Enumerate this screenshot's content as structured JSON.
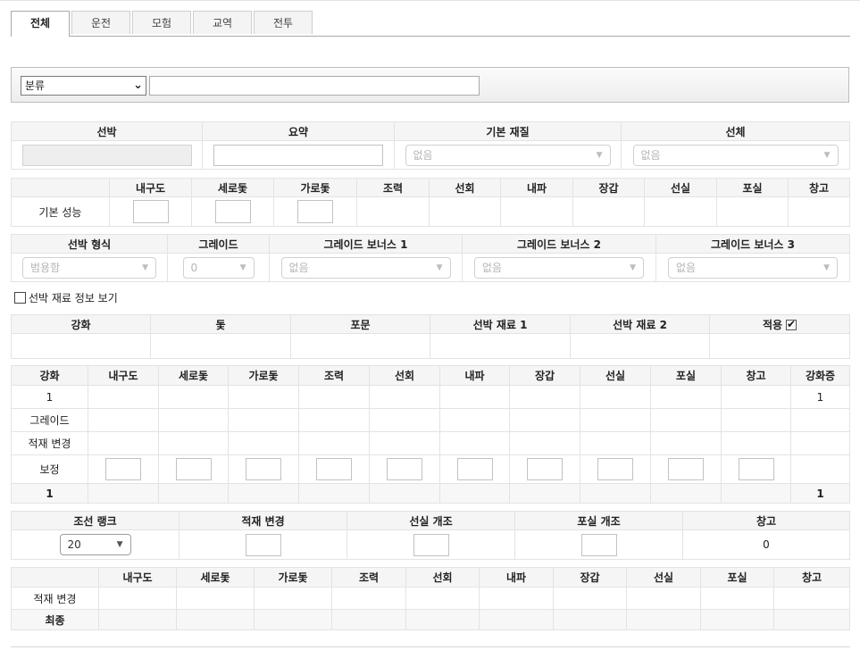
{
  "tabs": [
    "전체",
    "운전",
    "모험",
    "교역",
    "전투"
  ],
  "filter": {
    "category_value": "분류",
    "search_value": ""
  },
  "ship_info": {
    "headers": [
      "선박",
      "요약",
      "기본 재질",
      "선체"
    ],
    "material_value": "없음",
    "hull_value": "없음"
  },
  "base_perf": {
    "headers": [
      "",
      "내구도",
      "세로돛",
      "가로돛",
      "조력",
      "선회",
      "내파",
      "장갑",
      "선실",
      "포실",
      "창고"
    ],
    "row_label": "기본 성능"
  },
  "ship_type": {
    "headers": [
      "선박 형식",
      "그레이드",
      "그레이드 보너스 1",
      "그레이드 보너스 2",
      "그레이드 보너스 3"
    ],
    "values": [
      "범용함",
      "0",
      "없음",
      "없음",
      "없음"
    ]
  },
  "material_toggle_label": "선박 재료 정보 보기",
  "reinforce": {
    "headers": [
      "강화",
      "돛",
      "포문",
      "선박 재료 1",
      "선박 재료 2",
      "적용"
    ],
    "apply_checked": true
  },
  "stats": {
    "headers": [
      "강화",
      "내구도",
      "세로돛",
      "가로돛",
      "조력",
      "선회",
      "내파",
      "장갑",
      "선실",
      "포실",
      "창고",
      "강화증"
    ],
    "rows": [
      {
        "label": "1",
        "last": "1"
      },
      {
        "label": "그레이드",
        "last": ""
      },
      {
        "label": "적재 변경",
        "last": ""
      },
      {
        "label": "보정",
        "last": ""
      },
      {
        "label": "1",
        "last": "1"
      }
    ]
  },
  "build": {
    "headers": [
      "조선 랭크",
      "적재 변경",
      "선실 개조",
      "포실 개조",
      "창고"
    ],
    "rank_value": "20",
    "storage_value": "0"
  },
  "final": {
    "headers": [
      "",
      "내구도",
      "세로돛",
      "가로돛",
      "조력",
      "선회",
      "내파",
      "장갑",
      "선실",
      "포실",
      "창고"
    ],
    "rows": [
      "적재 변경",
      "최종"
    ]
  }
}
